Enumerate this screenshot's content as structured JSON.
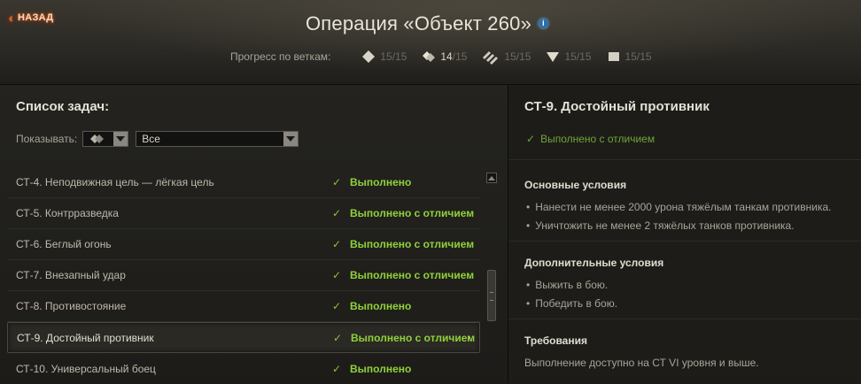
{
  "header": {
    "back_label": "НАЗАД",
    "title": "Операция «Объект 260»",
    "progress_label": "Прогресс по веткам:",
    "branches": [
      {
        "icon": "diamond-icon",
        "done": "15",
        "total": "/15"
      },
      {
        "icon": "double-diamond-icon",
        "done": "14",
        "total": "/15"
      },
      {
        "icon": "triple-stripe-icon",
        "done": "15",
        "total": "/15"
      },
      {
        "icon": "triangle-down-icon",
        "done": "15",
        "total": "/15"
      },
      {
        "icon": "square-icon",
        "done": "15",
        "total": "/15"
      }
    ]
  },
  "tasks_panel": {
    "title": "Список задач:",
    "filter_label": "Показывать:",
    "filter_value": "Все",
    "tasks": [
      {
        "name": "СТ-4. Неподвижная цель — лёгкая цель",
        "status": "Выполнено"
      },
      {
        "name": "СТ-5. Контрразведка",
        "status": "Выполнено с отличием"
      },
      {
        "name": "СТ-6. Беглый огонь",
        "status": "Выполнено с отличием"
      },
      {
        "name": "СТ-7. Внезапный удар",
        "status": "Выполнено с отличием"
      },
      {
        "name": "СТ-8. Противостояние",
        "status": "Выполнено"
      },
      {
        "name": "СТ-9. Достойный противник",
        "status": "Выполнено с отличием",
        "selected": true
      },
      {
        "name": "СТ-10. Универсальный боец",
        "status": "Выполнено"
      }
    ]
  },
  "detail": {
    "title": "СТ-9. Достойный противник",
    "status": "Выполнено с отличием",
    "main_conditions_title": "Основные условия",
    "main_conditions": [
      "Нанести не менее 2000 урона тяжёлым танкам противника.",
      "Уничтожить не менее 2 тяжёлых танков противника."
    ],
    "extra_conditions_title": "Дополнительные условия",
    "extra_conditions": [
      "Выжить в бою.",
      "Победить в бою."
    ],
    "requirements_title": "Требования",
    "requirements_text": "Выполнение доступно на СТ VI уровня и выше."
  },
  "colors": {
    "success": "#8fd23a",
    "accent_orange": "#ff6a20",
    "info_blue": "#2f6fa8"
  }
}
